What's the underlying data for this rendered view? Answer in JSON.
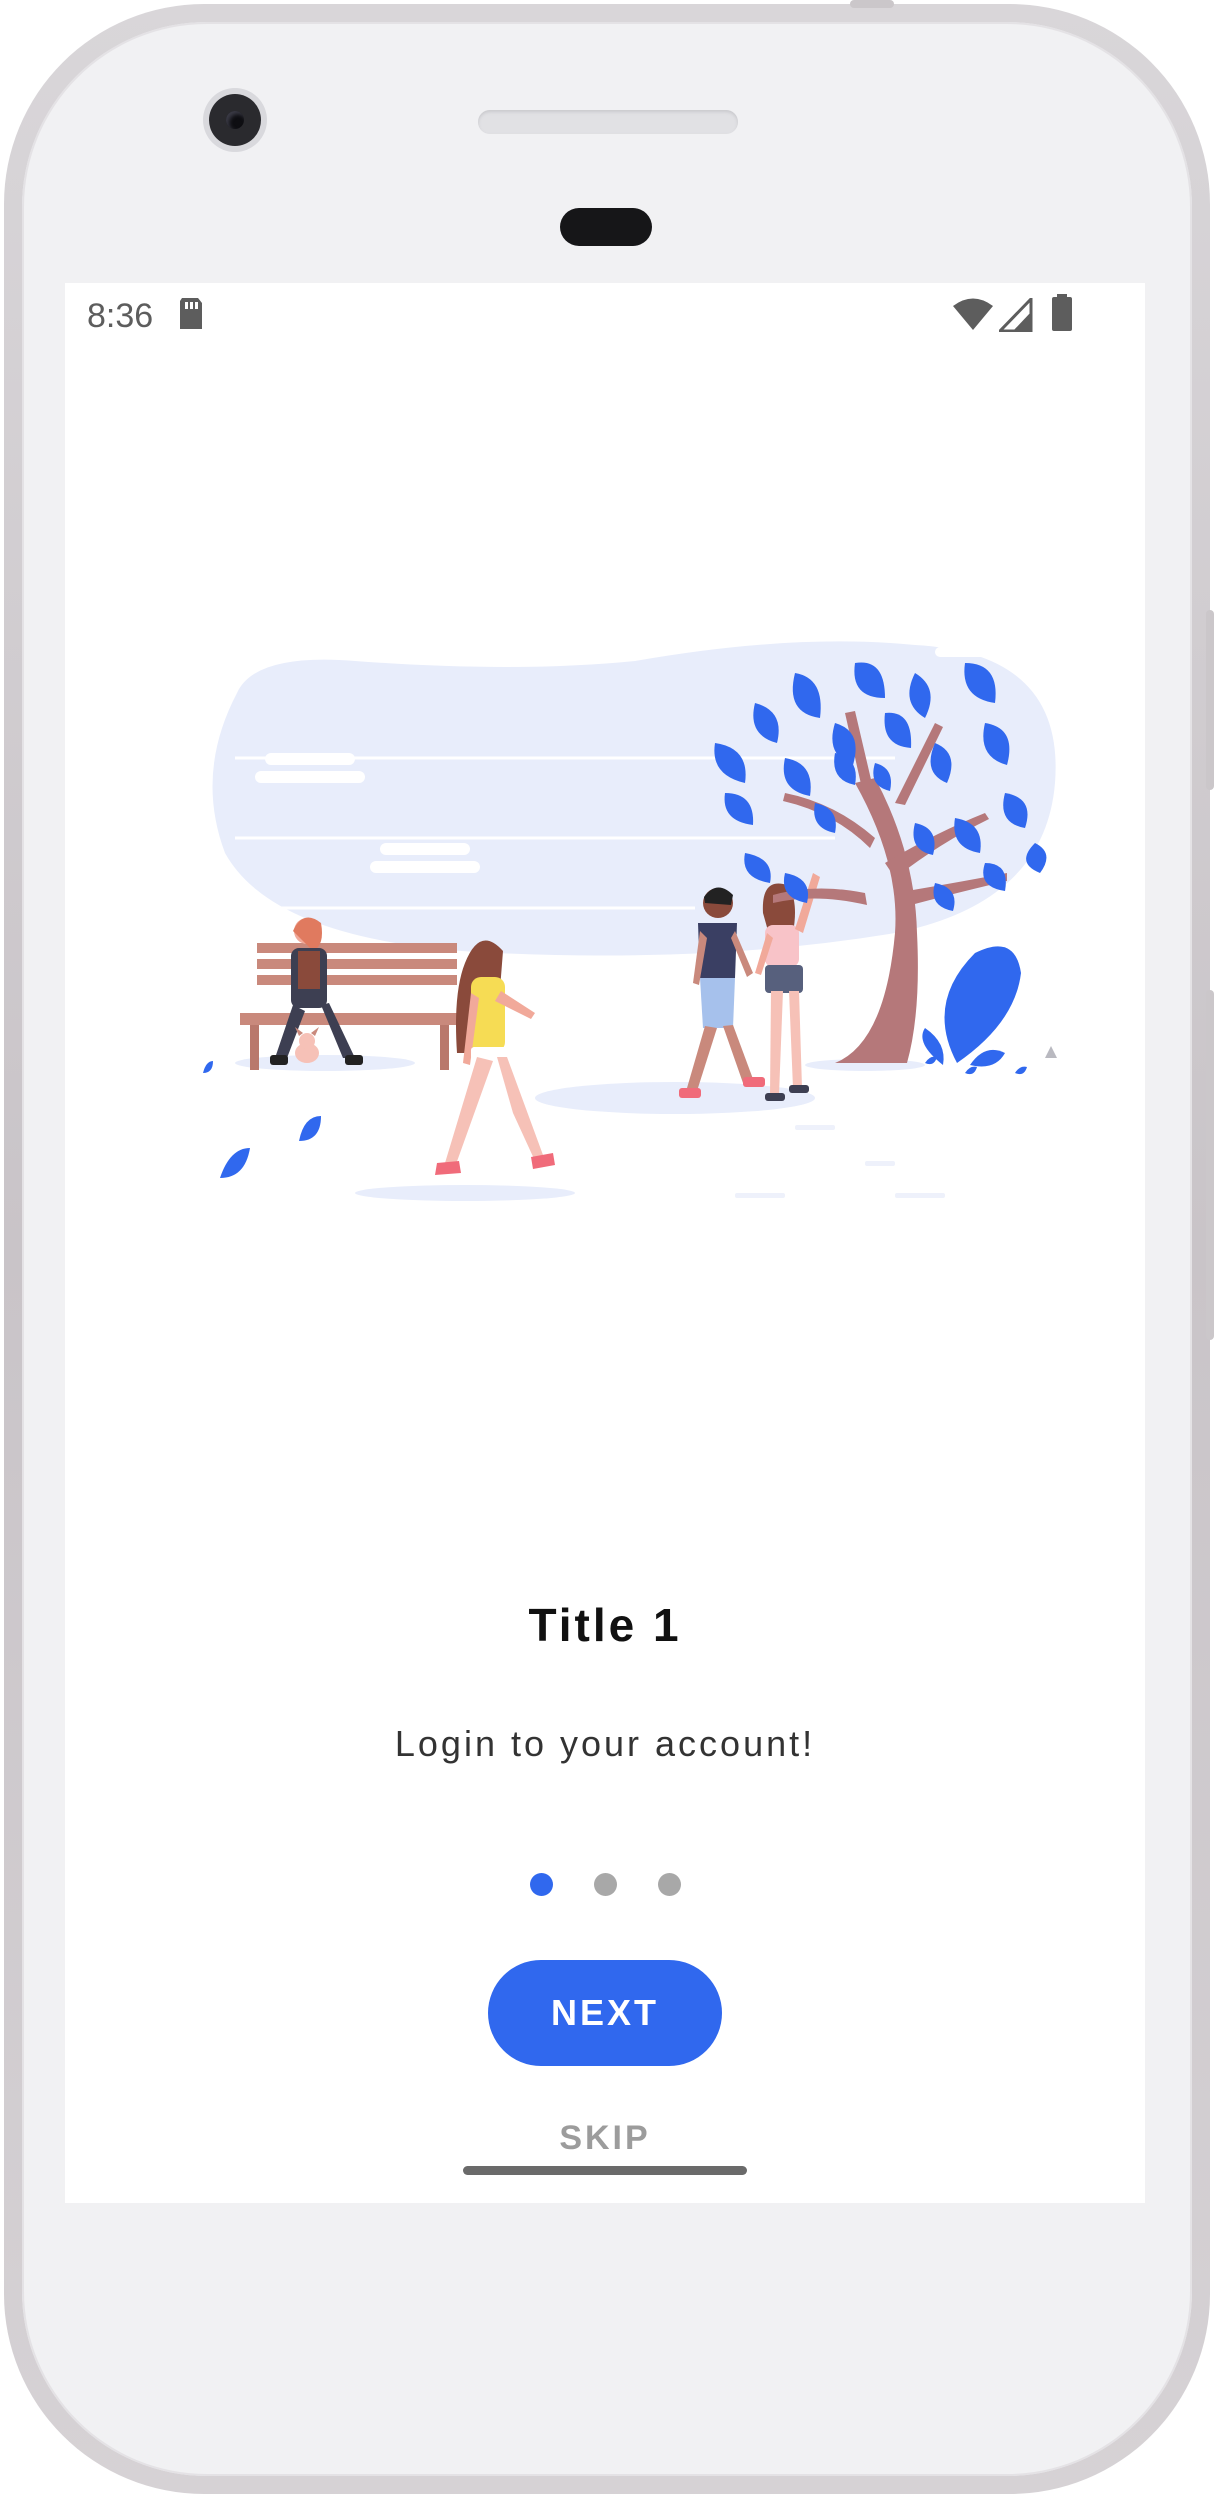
{
  "status_bar": {
    "time": "8:36",
    "icons": [
      "sd-card-icon",
      "wifi-icon",
      "signal-icon",
      "battery-icon"
    ]
  },
  "onboarding": {
    "title": "Title 1",
    "subtitle": "Login to your account!",
    "page_indicator": {
      "total": 3,
      "current": 1
    },
    "next_label": "NEXT",
    "skip_label": "SKIP"
  },
  "colors": {
    "accent": "#3068ee",
    "indicator_inactive": "#a8a8a8",
    "title_text": "#111111",
    "skip_text": "#9c9c9c"
  }
}
